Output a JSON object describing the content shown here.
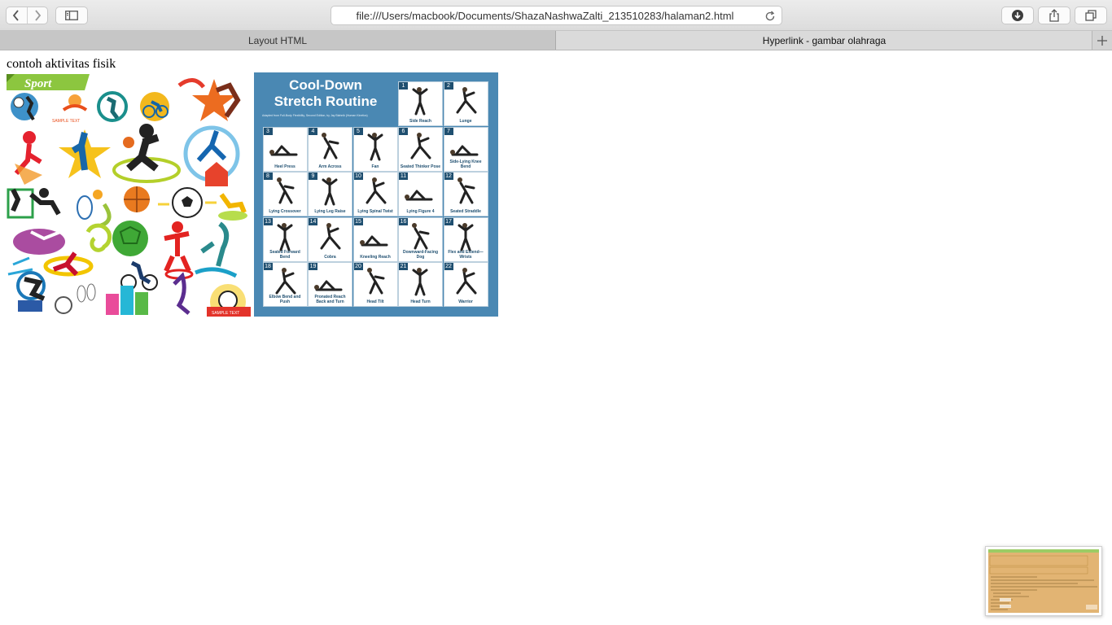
{
  "browser": {
    "address_url": "file:///Users/macbook/Documents/ShazaNashwaZalti_213510283/halaman2.html",
    "icons": {
      "back": "chevron-left-icon",
      "forward": "chevron-right-icon",
      "sidebar": "sidebar-icon",
      "reload": "reload-icon",
      "downloads": "download-icon",
      "share": "share-icon",
      "tabs": "tabs-overview-icon",
      "new_tab": "plus-icon"
    }
  },
  "tabs": [
    {
      "label": "Layout HTML",
      "active": false
    },
    {
      "label": "Hyperlink - gambar olahraga",
      "active": true
    }
  ],
  "page": {
    "heading": "contoh aktivitas fisik",
    "image1": {
      "banner": "Sport",
      "caption1": "SAMPLE TEXT",
      "caption2": "SAMPLE TEXT"
    },
    "image2": {
      "title_line1": "Cool-Down",
      "title_line2": "Stretch Routine",
      "subtitle": "Adapted from Full-Body Flexibility, Second Edition, by Jay Blahnik (Human Kinetics)",
      "stretches": [
        {
          "num": "1",
          "label": "Side Reach"
        },
        {
          "num": "2",
          "label": "Lunge"
        },
        {
          "num": "3",
          "label": "Heel Press"
        },
        {
          "num": "4",
          "label": "Arm Across"
        },
        {
          "num": "5",
          "label": "Fan"
        },
        {
          "num": "6",
          "label": "Seated Thinker Pose"
        },
        {
          "num": "7",
          "label": "Side-Lying Knee Bend"
        },
        {
          "num": "8",
          "label": "Lying Crossover"
        },
        {
          "num": "9",
          "label": "Lying Leg Raise"
        },
        {
          "num": "10",
          "label": "Lying Spinal Twist"
        },
        {
          "num": "11",
          "label": "Lying Figure 4"
        },
        {
          "num": "12",
          "label": "Seated Straddle"
        },
        {
          "num": "13",
          "label": "Seated Forward Bend"
        },
        {
          "num": "14",
          "label": "Cobra"
        },
        {
          "num": "15",
          "label": "Kneeling Reach"
        },
        {
          "num": "16",
          "label": "Downward-Facing Dog"
        },
        {
          "num": "17",
          "label": "Flex and Extend—Wrists"
        },
        {
          "num": "18",
          "label": "Elbow Bend and Push"
        },
        {
          "num": "19",
          "label": "Pronated Reach Back and Turn"
        },
        {
          "num": "20",
          "label": "Head Tilt"
        },
        {
          "num": "21",
          "label": "Head Turn"
        },
        {
          "num": "22",
          "label": "Warrior"
        }
      ]
    }
  },
  "colors": {
    "stretch_bg": "#4a88b3",
    "stretch_num": "#1f4f70",
    "sport_green": "#8cc63f",
    "thumb_bg": "#e2b473"
  }
}
